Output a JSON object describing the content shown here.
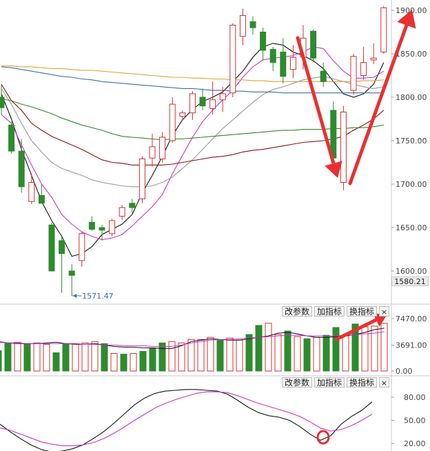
{
  "buttons": {
    "params_label": "改参数",
    "add_indicator_label": "加指标",
    "switch_indicator_label": "换指标",
    "close_label": "×"
  },
  "chart_data": [
    {
      "type": "candlestick",
      "panel": "price",
      "yticks": [
        "1900.00",
        "1850.00",
        "1800.00",
        "1750.00",
        "1700.00",
        "1650.00",
        "1600.00"
      ],
      "ylim": [
        1565,
        1915
      ],
      "current_price_label": "1580.21",
      "low_annotation": {
        "value": 1571.47,
        "label": "1571.47",
        "candle_index": 7
      },
      "up_color": "#d03030",
      "down_color": "#2e8b2e",
      "candles": [
        {
          "o": 1800,
          "h": 1815,
          "l": 1780,
          "c": 1788
        },
        {
          "o": 1768,
          "h": 1772,
          "l": 1735,
          "c": 1738
        },
        {
          "o": 1738,
          "h": 1752,
          "l": 1690,
          "c": 1697
        },
        {
          "o": 1680,
          "h": 1712,
          "l": 1677,
          "c": 1702
        },
        {
          "o": 1687,
          "h": 1700,
          "l": 1678,
          "c": 1678
        },
        {
          "o": 1653,
          "h": 1656,
          "l": 1600,
          "c": 1600
        },
        {
          "o": 1635,
          "h": 1641,
          "l": 1575,
          "c": 1620
        },
        {
          "o": 1600,
          "h": 1608,
          "l": 1571.47,
          "c": 1595
        },
        {
          "o": 1612,
          "h": 1645,
          "l": 1605,
          "c": 1643
        },
        {
          "o": 1656,
          "h": 1663,
          "l": 1646,
          "c": 1648
        },
        {
          "o": 1650,
          "h": 1653,
          "l": 1635,
          "c": 1647
        },
        {
          "o": 1643,
          "h": 1660,
          "l": 1640,
          "c": 1658
        },
        {
          "o": 1663,
          "h": 1676,
          "l": 1659,
          "c": 1673
        },
        {
          "o": 1678,
          "h": 1683,
          "l": 1665,
          "c": 1673
        },
        {
          "o": 1683,
          "h": 1732,
          "l": 1678,
          "c": 1729
        },
        {
          "o": 1730,
          "h": 1758,
          "l": 1720,
          "c": 1743
        },
        {
          "o": 1729,
          "h": 1760,
          "l": 1725,
          "c": 1754
        },
        {
          "o": 1750,
          "h": 1800,
          "l": 1748,
          "c": 1792
        },
        {
          "o": 1778,
          "h": 1785,
          "l": 1775,
          "c": 1782
        },
        {
          "o": 1782,
          "h": 1807,
          "l": 1774,
          "c": 1804
        },
        {
          "o": 1800,
          "h": 1810,
          "l": 1785,
          "c": 1790
        },
        {
          "o": 1787,
          "h": 1818,
          "l": 1780,
          "c": 1797
        },
        {
          "o": 1797,
          "h": 1812,
          "l": 1783,
          "c": 1804
        },
        {
          "o": 1805,
          "h": 1885,
          "l": 1800,
          "c": 1883
        },
        {
          "o": 1870,
          "h": 1902,
          "l": 1860,
          "c": 1894
        },
        {
          "o": 1887,
          "h": 1893,
          "l": 1872,
          "c": 1880
        },
        {
          "o": 1875,
          "h": 1880,
          "l": 1843,
          "c": 1854
        },
        {
          "o": 1855,
          "h": 1858,
          "l": 1830,
          "c": 1840
        },
        {
          "o": 1852,
          "h": 1868,
          "l": 1816,
          "c": 1824
        },
        {
          "o": 1832,
          "h": 1860,
          "l": 1822,
          "c": 1846
        },
        {
          "o": 1846,
          "h": 1883,
          "l": 1832,
          "c": 1868
        },
        {
          "o": 1876,
          "h": 1878,
          "l": 1840,
          "c": 1845
        },
        {
          "o": 1830,
          "h": 1840,
          "l": 1812,
          "c": 1818
        },
        {
          "o": 1785,
          "h": 1795,
          "l": 1738,
          "c": 1730
        },
        {
          "o": 1702,
          "h": 1790,
          "l": 1693,
          "c": 1783
        },
        {
          "o": 1808,
          "h": 1850,
          "l": 1803,
          "c": 1847
        },
        {
          "o": 1825,
          "h": 1858,
          "l": 1820,
          "c": 1840
        },
        {
          "o": 1843,
          "h": 1862,
          "l": 1838,
          "c": 1845
        },
        {
          "o": 1852,
          "h": 1905,
          "l": 1850,
          "c": 1903
        }
      ],
      "moving_averages": [
        {
          "color": "#111111",
          "values": [
            1804,
            1775,
            1740,
            1710,
            1680,
            1658,
            1640,
            1617,
            1620,
            1628,
            1642,
            1648,
            1654,
            1665,
            1690,
            1710,
            1732,
            1756,
            1774,
            1786,
            1795,
            1800,
            1806,
            1818,
            1830,
            1846,
            1858,
            1862,
            1860,
            1852,
            1848,
            1842,
            1833,
            1818,
            1804,
            1800,
            1804,
            1815,
            1840
          ]
        },
        {
          "color": "#cc33cc",
          "values": [
            1780,
            1770,
            1745,
            1722,
            1700,
            1685,
            1665,
            1654,
            1645,
            1640,
            1636,
            1638,
            1642,
            1652,
            1663,
            1674,
            1688,
            1712,
            1733,
            1754,
            1772,
            1785,
            1797,
            1808,
            1823,
            1835,
            1843,
            1845,
            1846,
            1848,
            1852,
            1858,
            1856,
            1842,
            1830,
            1822,
            1822,
            1823,
            1830
          ]
        },
        {
          "color": "#999999",
          "values": [
            1810,
            1792,
            1770,
            1750,
            1737,
            1725,
            1718,
            1714,
            1710,
            1705,
            1702,
            1700,
            1698,
            1697,
            1697,
            1698,
            1702,
            1708,
            1718,
            1728,
            1740,
            1752,
            1764,
            1774,
            1784,
            1794,
            1803,
            1809,
            1812,
            1816,
            1820,
            1822,
            1824,
            1821,
            1818,
            1815,
            1812,
            1810,
            1812
          ]
        },
        {
          "color": "#8b1010",
          "values": [
            1815,
            1796,
            1785,
            1770,
            1762,
            1755,
            1750,
            1745,
            1740,
            1734,
            1728,
            1725,
            1724,
            1722,
            1722,
            1722,
            1722,
            1723,
            1725,
            1727,
            1729,
            1731,
            1732,
            1734,
            1737,
            1739,
            1740,
            1742,
            1744,
            1746,
            1748,
            1749,
            1750,
            1752,
            1755,
            1762,
            1768,
            1775,
            1785
          ]
        },
        {
          "color": "#2a8a2a",
          "values": [
            1798,
            1796,
            1792,
            1789,
            1785,
            1781,
            1776,
            1772,
            1768,
            1765,
            1762,
            1758,
            1755,
            1754,
            1753,
            1752,
            1751,
            1752,
            1752,
            1753,
            1754,
            1755,
            1756,
            1757,
            1758,
            1759,
            1760,
            1761,
            1762,
            1762,
            1763,
            1763,
            1763,
            1764,
            1764,
            1765,
            1765,
            1766,
            1768
          ]
        },
        {
          "color": "#e8a030",
          "values": [
            1836,
            1836,
            1835,
            1835,
            1834,
            1833,
            1833,
            1832,
            1831,
            1831,
            1830,
            1829,
            1828,
            1827,
            1826,
            1825,
            1824,
            1823,
            1823,
            1822,
            1822,
            1821,
            1821,
            1820,
            1820,
            1819,
            1819,
            1818,
            1818,
            1818,
            1818,
            1818,
            1818,
            1818,
            1818,
            1818,
            1819,
            1819,
            1820
          ]
        },
        {
          "color": "#3a6fb0",
          "values": [
            1835,
            1834,
            1832,
            1830,
            1828,
            1826,
            1824,
            1823,
            1821,
            1820,
            1818,
            1817,
            1816,
            1815,
            1814,
            1813,
            1812,
            1811,
            1810,
            1810,
            1809,
            1808,
            1808,
            1807,
            1807,
            1806,
            1806,
            1806,
            1805,
            1805,
            1805,
            1805,
            1805,
            1805,
            1805,
            1805,
            1805,
            1805,
            1805
          ]
        }
      ],
      "annotations": {
        "arrow_color": "#e83030",
        "arrows": [
          "down",
          "up"
        ]
      }
    },
    {
      "type": "bar",
      "panel": "volume",
      "yticks": [
        "7470.00",
        "3691.00",
        "0.00"
      ],
      "ylim": [
        0,
        7470
      ],
      "values": [
        2900,
        4000,
        4100,
        3900,
        4000,
        3800,
        2600,
        3900,
        3900,
        4000,
        4200,
        3900,
        2500,
        2400,
        2500,
        2800,
        3200,
        4000,
        4200,
        4000,
        4500,
        4500,
        4800,
        4400,
        4700,
        4400,
        5200,
        6500,
        6800,
        5200,
        5700,
        4900,
        4600,
        4800,
        5100,
        6200,
        5000,
        6700,
        6300,
        6400,
        6800
      ],
      "directions": [
        "down",
        "down",
        "up",
        "down",
        "up",
        "up",
        "down",
        "down",
        "up",
        "up",
        "up",
        "down",
        "up",
        "down",
        "up",
        "down",
        "down",
        "down",
        "up",
        "up",
        "up",
        "up",
        "up",
        "down",
        "up",
        "up",
        "down",
        "down",
        "up",
        "up",
        "down",
        "up",
        "down",
        "up",
        "down",
        "down",
        "up",
        "down",
        "up",
        "up",
        "up"
      ],
      "lines": [
        {
          "color": "#111111",
          "values": [
            4200,
            4000,
            3900,
            3900,
            3900,
            4000,
            4100,
            3900,
            3800,
            3800,
            3900,
            3700,
            3500,
            3400,
            3400,
            3300,
            3300,
            3200,
            3200,
            3600,
            4200,
            4400,
            4600,
            4500,
            4400,
            4400,
            4600,
            4800,
            5000,
            5400,
            5500,
            5300,
            5000,
            4800,
            4800,
            4900,
            5000,
            5200,
            5500,
            5900,
            6100
          ]
        },
        {
          "color": "#cc33cc",
          "values": [
            4100,
            4000,
            4000,
            3900,
            3900,
            3900,
            3900,
            3900,
            3900,
            3800,
            3800,
            3700,
            3700,
            3600,
            3600,
            3600,
            3500,
            3500,
            3500,
            3700,
            4000,
            4200,
            4400,
            4500,
            4500,
            4600,
            4700,
            4800,
            4900,
            5000,
            5100,
            5100,
            5000,
            5000,
            5000,
            5000,
            5100,
            5200,
            5300,
            5400,
            5600
          ]
        }
      ]
    },
    {
      "type": "line",
      "panel": "oscillator",
      "yticks": [
        "80.00",
        "50.00",
        "20.00"
      ],
      "ylim": [
        0,
        100
      ],
      "series": [
        {
          "color": "#111111",
          "values": [
            45,
            35,
            26,
            18,
            12,
            9,
            10,
            13,
            18,
            26,
            35,
            46,
            58,
            70,
            79,
            85,
            88,
            89,
            90,
            90,
            89,
            88,
            84,
            76,
            67,
            60,
            56,
            54,
            50,
            42,
            32,
            24,
            30,
            45,
            55,
            63,
            74
          ]
        },
        {
          "color": "#cc33cc",
          "values": [
            40,
            37,
            32,
            27,
            22,
            19,
            17,
            17,
            18,
            21,
            26,
            33,
            41,
            50,
            58,
            66,
            72,
            77,
            81,
            85,
            87,
            87,
            86,
            82,
            77,
            72,
            68,
            64,
            60,
            55,
            48,
            40,
            36,
            38,
            43,
            50,
            58
          ]
        }
      ],
      "marker": {
        "index": 31,
        "color": "#e83030"
      }
    }
  ]
}
